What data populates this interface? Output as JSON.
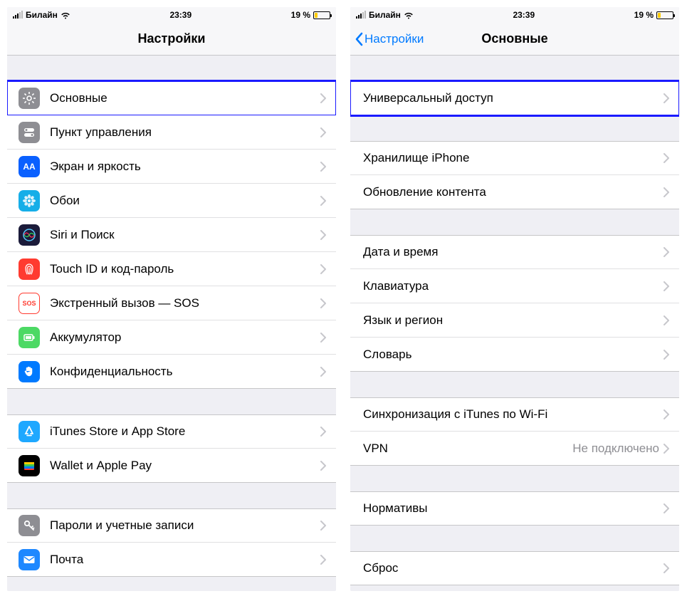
{
  "status": {
    "carrier": "Билайн",
    "time": "23:39",
    "battery_pct": "19 %"
  },
  "left": {
    "title": "Настройки",
    "groups": [
      [
        {
          "id": "general",
          "label": "Основные",
          "icon": "gear",
          "bg": "#8e8e93",
          "hl": true
        },
        {
          "id": "control",
          "label": "Пункт управления",
          "icon": "switch",
          "bg": "#8e8e93"
        },
        {
          "id": "display",
          "label": "Экран и яркость",
          "icon": "AA",
          "bg": "#0a60ff",
          "text": true
        },
        {
          "id": "wallpaper",
          "label": "Обои",
          "icon": "flower",
          "bg": "#16aee8"
        },
        {
          "id": "siri",
          "label": "Siri и Поиск",
          "icon": "siri",
          "bg": "#1b1b3a"
        },
        {
          "id": "touchid",
          "label": "Touch ID и код-пароль",
          "icon": "finger",
          "bg": "#ff3b30"
        },
        {
          "id": "sos",
          "label": "Экстренный вызов — SOS",
          "icon": "SOS",
          "bg": "#ffffff",
          "fg": "#ff3b30",
          "text": true
        },
        {
          "id": "battery",
          "label": "Аккумулятор",
          "icon": "batt",
          "bg": "#4cd964"
        },
        {
          "id": "privacy",
          "label": "Конфиденциальность",
          "icon": "hand",
          "bg": "#007aff"
        }
      ],
      [
        {
          "id": "appstore",
          "label": "iTunes Store и App Store",
          "icon": "astore",
          "bg": "#1fa8ff"
        },
        {
          "id": "wallet",
          "label": "Wallet и Apple Pay",
          "icon": "wallet",
          "bg": "#000"
        }
      ],
      [
        {
          "id": "passwords",
          "label": "Пароли и учетные записи",
          "icon": "key",
          "bg": "#8e8e93"
        },
        {
          "id": "mail",
          "label": "Почта",
          "icon": "mail",
          "bg": "#1e88ff"
        }
      ]
    ]
  },
  "right": {
    "back": "Настройки",
    "title": "Основные",
    "groups": [
      [
        {
          "id": "accessibility",
          "label": "Универсальный доступ",
          "hl": true
        }
      ],
      [
        {
          "id": "storage",
          "label": "Хранилище iPhone"
        },
        {
          "id": "refresh",
          "label": "Обновление контента"
        }
      ],
      [
        {
          "id": "datetime",
          "label": "Дата и время"
        },
        {
          "id": "keyboard",
          "label": "Клавиатура"
        },
        {
          "id": "language",
          "label": "Язык и регион"
        },
        {
          "id": "dictionary",
          "label": "Словарь"
        }
      ],
      [
        {
          "id": "itunes-wifi",
          "label": "Синхронизация с iTunes по Wi-Fi"
        },
        {
          "id": "vpn",
          "label": "VPN",
          "detail": "Не подключено"
        }
      ],
      [
        {
          "id": "regulatory",
          "label": "Нормативы"
        }
      ],
      [
        {
          "id": "reset",
          "label": "Сброс"
        }
      ]
    ]
  }
}
